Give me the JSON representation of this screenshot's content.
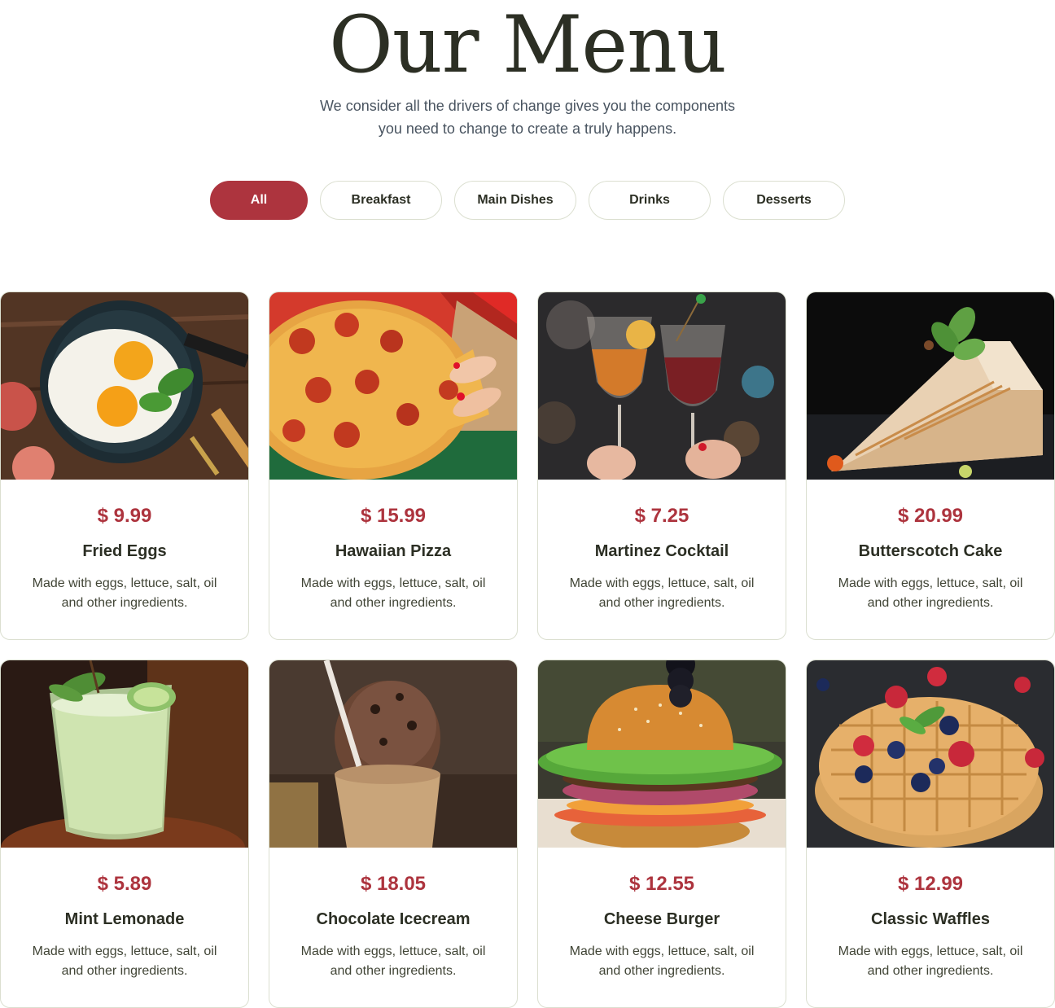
{
  "header": {
    "title": "Our Menu",
    "subtitle_line1": "We consider all the drivers of change gives you the components",
    "subtitle_line2": "you need to change to create a truly happens."
  },
  "filters": [
    "All",
    "Breakfast",
    "Main Dishes",
    "Drinks",
    "Desserts"
  ],
  "active_filter": "All",
  "colors": {
    "accent": "#ad343e",
    "text": "#2c2f24",
    "border": "#dbdfd0"
  },
  "items": [
    {
      "price": "$ 9.99",
      "name": "Fried Eggs",
      "desc1": "Made with eggs, lettuce, salt, oil",
      "desc2": "and other ingredients.",
      "image": "fried-eggs-photo"
    },
    {
      "price": "$ 15.99",
      "name": "Hawaiian Pizza",
      "desc1": "Made with eggs, lettuce, salt, oil",
      "desc2": "and other ingredients.",
      "image": "pizza-photo"
    },
    {
      "price": "$ 7.25",
      "name": "Martinez Cocktail",
      "desc1": "Made with eggs, lettuce, salt, oil",
      "desc2": "and other ingredients.",
      "image": "cocktail-photo"
    },
    {
      "price": "$ 20.99",
      "name": "Butterscotch Cake",
      "desc1": "Made with eggs, lettuce, salt, oil",
      "desc2": "and other ingredients.",
      "image": "cake-photo"
    },
    {
      "price": "$ 5.89",
      "name": "Mint Lemonade",
      "desc1": "Made with eggs, lettuce, salt, oil",
      "desc2": "and other ingredients.",
      "image": "lemonade-photo"
    },
    {
      "price": "$ 18.05",
      "name": "Chocolate Icecream",
      "desc1": "Made with eggs, lettuce, salt, oil",
      "desc2": "and other ingredients.",
      "image": "icecream-photo"
    },
    {
      "price": "$ 12.55",
      "name": "Cheese Burger",
      "desc1": "Made with eggs, lettuce, salt, oil",
      "desc2": "and other ingredients.",
      "image": "burger-photo"
    },
    {
      "price": "$ 12.99",
      "name": "Classic Waffles",
      "desc1": "Made with eggs, lettuce, salt, oil",
      "desc2": "and other ingredients.",
      "image": "waffles-photo"
    }
  ]
}
